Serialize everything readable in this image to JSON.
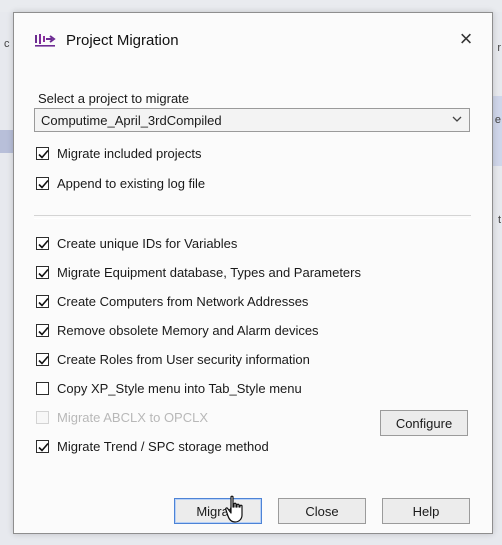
{
  "background": {
    "left_char": "c",
    "right_chars": [
      "r",
      "e",
      "t"
    ]
  },
  "dialog": {
    "title": "Project Migration",
    "close_symbol": "×",
    "select_label": "Select a project to migrate",
    "select_value": "Computime_April_3rdCompiled",
    "checkboxes_top": [
      {
        "label": "Migrate included projects",
        "checked": true
      },
      {
        "label": "Append to existing log file",
        "checked": true
      }
    ],
    "checkboxes_main": [
      {
        "label": "Create unique IDs for Variables",
        "checked": true,
        "disabled": false
      },
      {
        "label": "Migrate Equipment database, Types and Parameters",
        "checked": true,
        "disabled": false
      },
      {
        "label": "Create Computers from Network Addresses",
        "checked": true,
        "disabled": false
      },
      {
        "label": "Remove obsolete Memory and Alarm devices",
        "checked": true,
        "disabled": false
      },
      {
        "label": "Create Roles from User security information",
        "checked": true,
        "disabled": false
      },
      {
        "label": "Copy XP_Style menu into Tab_Style menu",
        "checked": false,
        "disabled": false
      },
      {
        "label": "Migrate ABCLX to OPCLX",
        "checked": false,
        "disabled": true
      },
      {
        "label": "Migrate Trend / SPC storage method",
        "checked": true,
        "disabled": false
      }
    ],
    "buttons": {
      "configure": "Configure",
      "migrate": "Migrate",
      "close": "Close",
      "help": "Help"
    }
  },
  "icons": {
    "title_icon": "project-migration-icon",
    "close_icon": "close-icon",
    "dropdown_icon": "chevron-down-icon",
    "cursor_icon": "hand-cursor-icon"
  },
  "colors": {
    "focus_border": "#4d83d6",
    "disabled_text": "#b8b8b8",
    "dialog_bg": "#fbfbfb"
  }
}
